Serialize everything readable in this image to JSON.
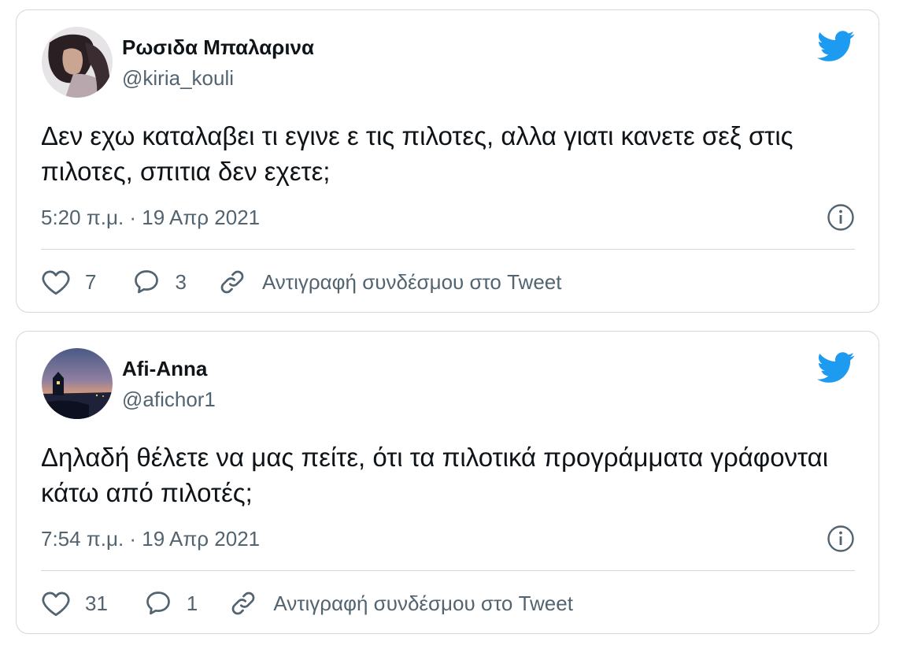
{
  "colors": {
    "twitter_blue": "#1d9bf0",
    "text_primary": "#0f1419",
    "text_secondary": "#536471",
    "border": "#cfd9de"
  },
  "tweets": [
    {
      "name": "Ρωσιδα Μπαλαρινα",
      "handle": "@kiria_kouli",
      "text": "Δεν εχω καταλαβει τι εγινε ε τις πιλοτες, αλλα γιατι κανετε σεξ στις πιλοτες, σπιτια δεν εχετε;",
      "timestamp": "5:20 π.μ. · 19 Απρ 2021",
      "likes": "7",
      "replies": "3",
      "copy_link_label": "Αντιγραφή συνδέσμου στο Tweet",
      "icons": {
        "logo": "twitter-bird-icon",
        "info": "info-icon",
        "like": "heart-icon",
        "reply": "speech-bubble-icon",
        "copy": "link-icon"
      }
    },
    {
      "name": "Afi-Anna",
      "handle": "@afichor1",
      "text": "Δηλαδή θέλετε να μας πείτε, ότι τα πιλοτικά προγράμματα γράφονται κάτω από πιλοτές;",
      "timestamp": "7:54 π.μ. · 19 Απρ 2021",
      "likes": "31",
      "replies": "1",
      "copy_link_label": "Αντιγραφή συνδέσμου στο Tweet",
      "icons": {
        "logo": "twitter-bird-icon",
        "info": "info-icon",
        "like": "heart-icon",
        "reply": "speech-bubble-icon",
        "copy": "link-icon"
      }
    }
  ]
}
